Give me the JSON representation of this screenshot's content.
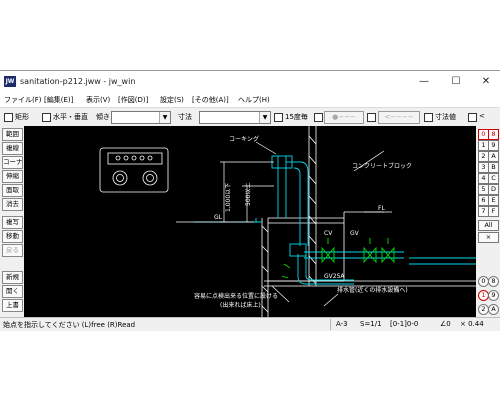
{
  "window": {
    "title": "sanitation-p212.jww - jw_win",
    "icon_text": "JW",
    "controls": {
      "minimize": "—",
      "maximize": "☐",
      "close": "✕"
    }
  },
  "menu": [
    "ファイル(F)",
    "[編集(E)]",
    "表示(V)",
    "[作図(D)]",
    "設定(S)",
    "[その他(A)]",
    "ヘルプ(H)"
  ],
  "toolbar": {
    "rect_label": "矩形",
    "horiz_vert_label": "水平・垂直",
    "slope_label": "傾き",
    "dim_label": "寸法",
    "deg15_label": "15度毎",
    "btn_a": "●−−−",
    "btn_b": "<−−−−",
    "dimval_label": "寸法値",
    "lt_label": "<"
  },
  "left_tools": [
    "範囲",
    "複線",
    "コーナー",
    "伸縮",
    "面取",
    "消去",
    "複写",
    "移動",
    "戻る",
    "新規",
    "開く",
    "上書"
  ],
  "right_tools": {
    "col1": [
      "0",
      "1",
      "2",
      "3",
      "4",
      "5",
      "6",
      "7",
      "8",
      "9",
      "A",
      "B",
      "C",
      "D",
      "E",
      "F"
    ],
    "all_label": "All",
    "arrow_label": "×",
    "bottom": [
      "0",
      "8",
      "1",
      "9",
      "2",
      "A"
    ]
  },
  "drawing": {
    "label_caulking": "コーキング",
    "label_concrete": "コンクリートブロック",
    "label_dim": "500以上",
    "label_dim2": "1,000以下",
    "label_gl": "GL",
    "label_fl": "FL",
    "label_cv": "CV",
    "label_gv": "GV",
    "label_pipe": "GV25A",
    "label_drain": "排水管(近くの排水設備へ)",
    "label_note1": "容易に点検出来る位置に設ける",
    "label_note2": "(出来れば床上)"
  },
  "status": {
    "message": "始点を指示してください (L)free (R)Read",
    "paper": "A-3",
    "scale": "S=1/1",
    "layer": "[0-1]0-0",
    "angle": "∠0",
    "zoom": "× 0.44"
  },
  "colors": {
    "drawing_cyan": "#00d8e8",
    "drawing_green": "#00e000",
    "drawing_white": "#ffffff",
    "active_red": "#d00000",
    "app_icon": "#1e2b6b"
  }
}
